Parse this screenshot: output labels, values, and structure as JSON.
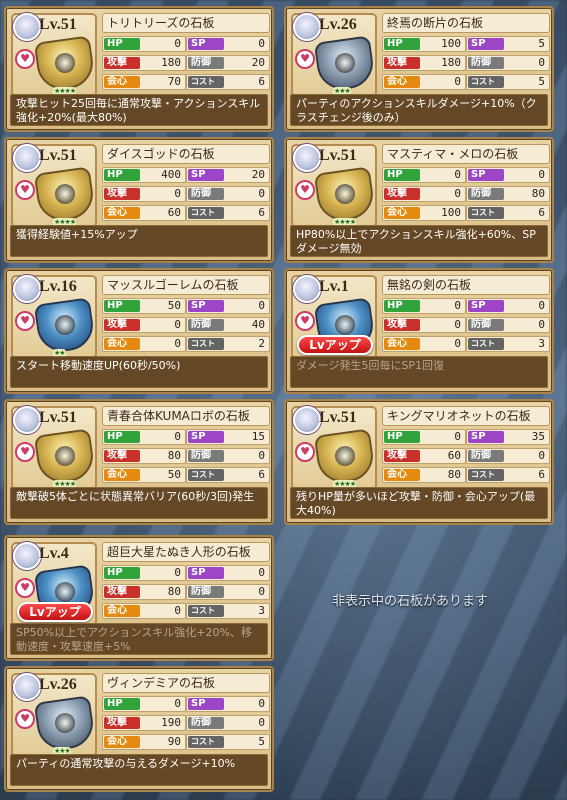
{
  "labels": {
    "hp": "HP",
    "sp": "SP",
    "atk": "攻撃",
    "def": "防御",
    "crit": "会心",
    "cost": "コスト",
    "lvup": "Lvアップ"
  },
  "hidden_notice": "非表示中の石板があります",
  "colors": {
    "card": "#e9d3a3",
    "hp_tag": "#32a33a",
    "sp_tag": "#9c45c7",
    "atk_tag": "#c8302c",
    "def_tag": "#7a7a7a",
    "crit_tag": "#e58a10",
    "lvup": "#d01b1b",
    "desc_bg": "#5a3e1c"
  },
  "cards": [
    {
      "lv": "Lv.51",
      "name": "トリトリーズの石板",
      "hp": "0",
      "sp": "0",
      "atk": "180",
      "def": "20",
      "crit": "70",
      "cost": "6",
      "stars": "★★★★",
      "stone": "gold",
      "lvup": false,
      "desc": "攻撃ヒット25回毎に通常攻撃・アクションスキル強化+20%(最大80%)",
      "desc_dim": false
    },
    {
      "lv": "Lv.26",
      "name": "終焉の断片の石板",
      "hp": "100",
      "sp": "5",
      "atk": "180",
      "def": "0",
      "crit": "0",
      "cost": "5",
      "stars": "★★★",
      "stone": "gray",
      "lvup": false,
      "desc": "パーティのアクションスキルダメージ+10%（クラスチェンジ後のみ）",
      "desc_dim": false
    },
    {
      "lv": "Lv.51",
      "name": "ダイスゴッドの石板",
      "hp": "400",
      "sp": "20",
      "atk": "0",
      "def": "0",
      "crit": "60",
      "cost": "6",
      "stars": "★★★★",
      "stone": "gold",
      "lvup": false,
      "desc": "獲得経験値+15%アップ",
      "desc_dim": false
    },
    {
      "lv": "Lv.51",
      "name": "マスティマ・メロの石板",
      "hp": "0",
      "sp": "0",
      "atk": "0",
      "def": "80",
      "crit": "100",
      "cost": "6",
      "stars": "★★★★",
      "stone": "gold",
      "lvup": false,
      "desc": "HP80%以上でアクションスキル強化+60%、SPダメージ無効",
      "desc_dim": false
    },
    {
      "lv": "Lv.16",
      "name": "マッスルゴーレムの石板",
      "hp": "50",
      "sp": "0",
      "atk": "0",
      "def": "40",
      "crit": "0",
      "cost": "2",
      "stars": "★★",
      "stone": "blue",
      "lvup": false,
      "desc": "スタート移動速度UP(60秒/50%)",
      "desc_dim": false
    },
    {
      "lv": "Lv.1",
      "name": "無銘の剣の石板",
      "hp": "0",
      "sp": "0",
      "atk": "0",
      "def": "0",
      "crit": "0",
      "cost": "3",
      "stars": "",
      "stone": "blue",
      "lvup": true,
      "desc": "ダメージ発生5回毎にSP1回復",
      "desc_dim": true
    },
    {
      "lv": "Lv.51",
      "name": "青春合体KUMAロボの石板",
      "hp": "0",
      "sp": "15",
      "atk": "80",
      "def": "0",
      "crit": "50",
      "cost": "6",
      "stars": "★★★★",
      "stone": "gold",
      "lvup": false,
      "desc": "敵撃破5体ごとに状態異常バリア(60秒/3回)発生",
      "desc_dim": false
    },
    {
      "lv": "Lv.51",
      "name": "キングマリオネットの石板",
      "hp": "0",
      "sp": "35",
      "atk": "60",
      "def": "0",
      "crit": "80",
      "cost": "6",
      "stars": "★★★★",
      "stone": "gold",
      "lvup": false,
      "desc": "残りHP量が多いほど攻撃・防御・会心アップ(最大40%)",
      "desc_dim": false
    },
    {
      "lv": "Lv.4",
      "name": "超巨大星たぬき人形の石板",
      "hp": "0",
      "sp": "0",
      "atk": "80",
      "def": "0",
      "crit": "0",
      "cost": "3",
      "stars": "",
      "stone": "blue",
      "lvup": true,
      "desc": "SP50%以上でアクションスキル強化+20%、移動速度・攻撃速度+5%",
      "desc_dim": true
    },
    {
      "lv": "Lv.26",
      "name": "ヴィンデミアの石板",
      "hp": "0",
      "sp": "0",
      "atk": "190",
      "def": "0",
      "crit": "90",
      "cost": "5",
      "stars": "★★★",
      "stone": "gray",
      "lvup": false,
      "desc": "パーティの通常攻撃の与えるダメージ+10%",
      "desc_dim": false
    }
  ]
}
